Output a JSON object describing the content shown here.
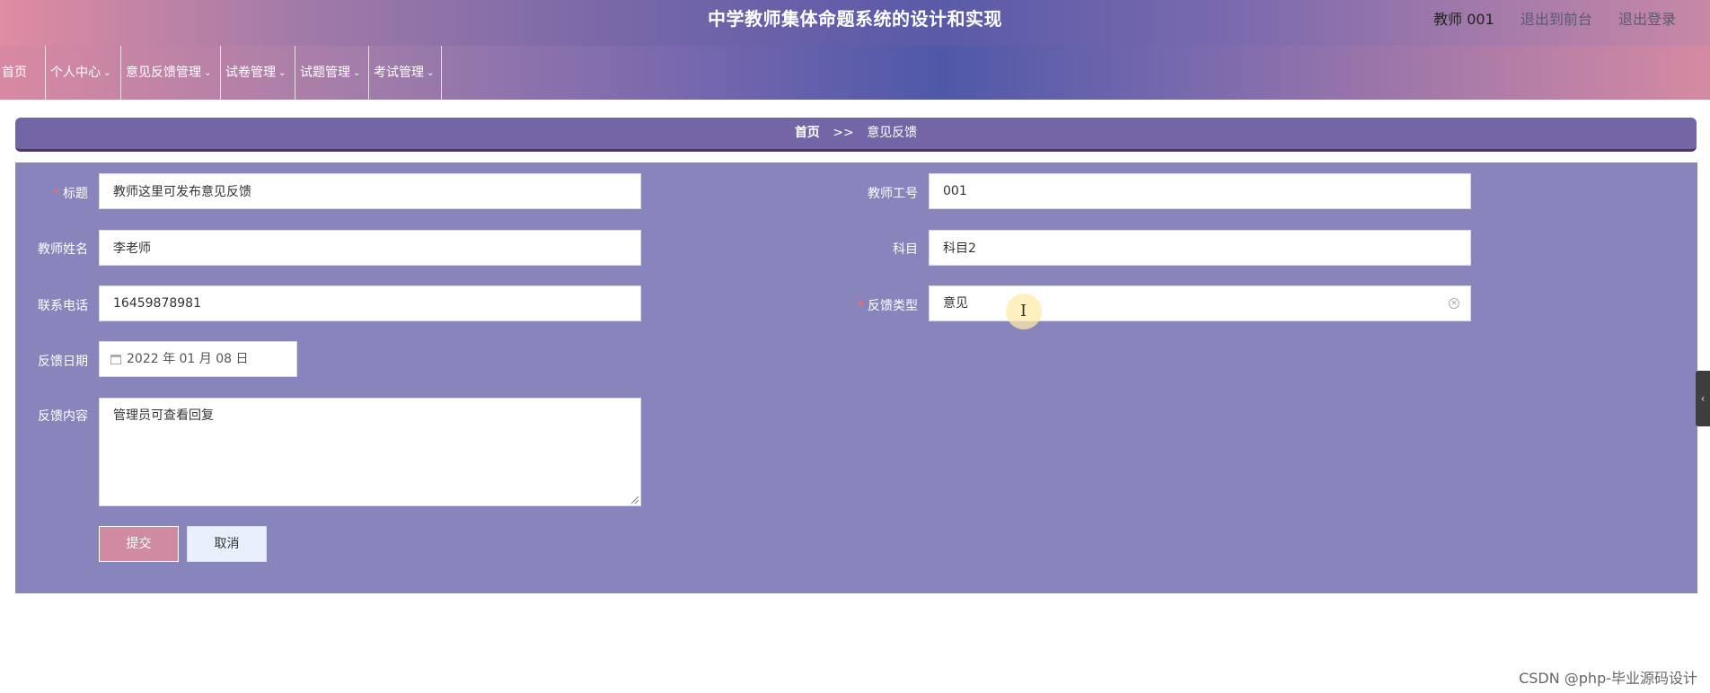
{
  "header": {
    "title": "中学教师集体命题系统的设计和实现",
    "user": "教师 001",
    "links": [
      "退出到前台",
      "退出登录"
    ]
  },
  "nav": {
    "items": [
      {
        "label": "首页",
        "dropdown": false
      },
      {
        "label": "个人中心",
        "dropdown": true
      },
      {
        "label": "意见反馈管理",
        "dropdown": true
      },
      {
        "label": "试卷管理",
        "dropdown": true
      },
      {
        "label": "试题管理",
        "dropdown": true
      },
      {
        "label": "考试管理",
        "dropdown": true
      }
    ]
  },
  "breadcrumb": {
    "home": "首页",
    "separator": ">>",
    "current": "意见反馈"
  },
  "form": {
    "title": {
      "label": "标题",
      "required": true,
      "value": "教师这里可发布意见反馈"
    },
    "teacher_id": {
      "label": "教师工号",
      "value": "001"
    },
    "teacher_name": {
      "label": "教师姓名",
      "value": "李老师"
    },
    "subject": {
      "label": "科目",
      "value": "科目2"
    },
    "phone": {
      "label": "联系电话",
      "value": "16459878981"
    },
    "feedback_type": {
      "label": "反馈类型",
      "required": true,
      "value": "意见"
    },
    "feedback_date": {
      "label": "反馈日期",
      "value": "2022 年 01 月 08 日"
    },
    "content": {
      "label": "反馈内容",
      "value": "管理员可查看回复"
    },
    "submit_label": "提交",
    "cancel_label": "取消"
  },
  "icons": {
    "calendar": "calendar-icon",
    "clear": "clear-circle-icon",
    "chevron": "chevron-down-icon",
    "side_tab": "chevron-left-icon"
  },
  "colors": {
    "form_background": "#8884bc",
    "breadcrumb_background": "#7466a6",
    "submit_button": "#d08aa2",
    "cancel_button": "#eaf0fb",
    "required_mark": "#f56c6c"
  },
  "watermark": "CSDN @php-毕业源码设计"
}
